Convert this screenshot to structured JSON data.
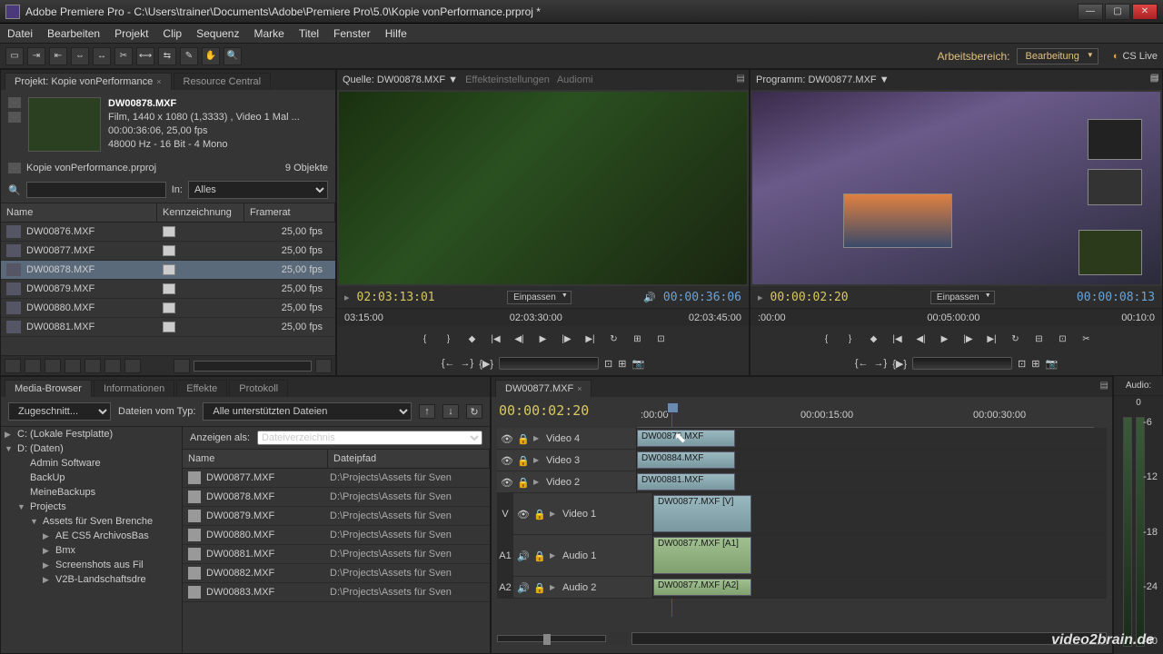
{
  "app": {
    "title": "Adobe Premiere Pro - C:\\Users\\trainer\\Documents\\Adobe\\Premiere Pro\\5.0\\Kopie vonPerformance.prproj *",
    "workspace_label": "Arbeitsbereich:",
    "workspace_value": "Bearbeitung",
    "cslive": "CS Live"
  },
  "menus": [
    "Datei",
    "Bearbeiten",
    "Projekt",
    "Clip",
    "Sequenz",
    "Marke",
    "Titel",
    "Fenster",
    "Hilfe"
  ],
  "project": {
    "tab": "Projekt: Kopie vonPerformance",
    "tab2": "Resource Central",
    "clip": {
      "name": "DW00878.MXF",
      "line1": "Film, 1440 x 1080 (1,3333)  , Video 1 Mal ...",
      "line2": "00:00:36:06, 25,00 fps",
      "line3": "48000 Hz - 16 Bit - 4 Mono"
    },
    "file": "Kopie vonPerformance.prproj",
    "count": "9 Objekte",
    "in_label": "In:",
    "in_value": "Alles",
    "cols": {
      "name": "Name",
      "kz": "Kennzeichnung",
      "fr": "Framerat"
    },
    "items": [
      {
        "name": "DW00876.MXF",
        "fr": "25,00 fps"
      },
      {
        "name": "DW00877.MXF",
        "fr": "25,00 fps"
      },
      {
        "name": "DW00878.MXF",
        "fr": "25,00 fps",
        "sel": true
      },
      {
        "name": "DW00879.MXF",
        "fr": "25,00 fps"
      },
      {
        "name": "DW00880.MXF",
        "fr": "25,00 fps"
      },
      {
        "name": "DW00881.MXF",
        "fr": "25,00 fps"
      }
    ]
  },
  "source": {
    "tab": "Quelle: DW00878.MXF",
    "tab2": "Effekteinstellungen",
    "tab3": "Audiomi",
    "tc_in": "02:03:13:01",
    "fit": "Einpassen",
    "tc_dur": "00:00:36:06",
    "ruler": [
      "03:15:00",
      "02:03:30:00",
      "02:03:45:00"
    ]
  },
  "program": {
    "tab": "Programm: DW00877.MXF",
    "tc_in": "00:00:02:20",
    "fit": "Einpassen",
    "tc_dur": "00:00:08:13",
    "ruler": [
      ":00:00",
      "00:05:00:00",
      "00:10:0"
    ]
  },
  "mb": {
    "tabs": [
      "Media-Browser",
      "Informationen",
      "Effekte",
      "Protokoll"
    ],
    "view": "Zugeschnitt...",
    "type_label": "Dateien vom Typ:",
    "type_value": "Alle unterstützten Dateien",
    "show_label": "Anzeigen als:",
    "show_value": "Dateiverzeichnis",
    "tree": [
      {
        "d": 0,
        "t": "▶",
        "l": "C: (Lokale Festplatte)"
      },
      {
        "d": 0,
        "t": "▼",
        "l": "D: (Daten)"
      },
      {
        "d": 1,
        "t": "",
        "l": "Admin Software"
      },
      {
        "d": 1,
        "t": "",
        "l": "BackUp"
      },
      {
        "d": 1,
        "t": "",
        "l": "MeineBackups"
      },
      {
        "d": 1,
        "t": "▼",
        "l": "Projects"
      },
      {
        "d": 2,
        "t": "▼",
        "l": "Assets für Sven Brenche"
      },
      {
        "d": 3,
        "t": "▶",
        "l": "AE CS5 ArchivosBas"
      },
      {
        "d": 3,
        "t": "▶",
        "l": "Bmx"
      },
      {
        "d": 3,
        "t": "▶",
        "l": "Screenshots aus Fil"
      },
      {
        "d": 3,
        "t": "▶",
        "l": "V2B-Landschaftsdre"
      }
    ],
    "cols": {
      "n": "Name",
      "p": "Dateipfad"
    },
    "files": [
      {
        "n": "DW00877.MXF",
        "p": "D:\\Projects\\Assets für Sven"
      },
      {
        "n": "DW00878.MXF",
        "p": "D:\\Projects\\Assets für Sven"
      },
      {
        "n": "DW00879.MXF",
        "p": "D:\\Projects\\Assets für Sven"
      },
      {
        "n": "DW00880.MXF",
        "p": "D:\\Projects\\Assets für Sven"
      },
      {
        "n": "DW00881.MXF",
        "p": "D:\\Projects\\Assets für Sven"
      },
      {
        "n": "DW00882.MXF",
        "p": "D:\\Projects\\Assets für Sven"
      },
      {
        "n": "DW00883.MXF",
        "p": "D:\\Projects\\Assets für Sven"
      }
    ]
  },
  "timeline": {
    "tab": "DW00877.MXF",
    "tc": "00:00:02:20",
    "ruler": [
      ":00:00",
      "00:00:15:00",
      "00:00:30:00"
    ],
    "meter_zero": "0",
    "tracks": [
      {
        "name": "Video 4",
        "clip": "DW00878.MXF"
      },
      {
        "name": "Video 3",
        "clip": "DW00884.MXF"
      },
      {
        "name": "Video 2",
        "clip": "DW00881.MXF"
      },
      {
        "name": "Video 1",
        "clip": "DW00877.MXF [V]",
        "tall": true,
        "label": "V"
      },
      {
        "name": "Audio 1",
        "clip": "DW00877.MXF [A1]",
        "audio": true,
        "tall": true,
        "label": "A1"
      },
      {
        "name": "Audio 2",
        "clip": "DW00877.MXF [A2]",
        "audio": true,
        "label": "A2"
      }
    ]
  },
  "audio_panel": "Audio:",
  "meter_ticks": [
    "-6",
    "-12",
    "-18",
    "-24",
    "-30"
  ],
  "watermark": "video2brain.de"
}
